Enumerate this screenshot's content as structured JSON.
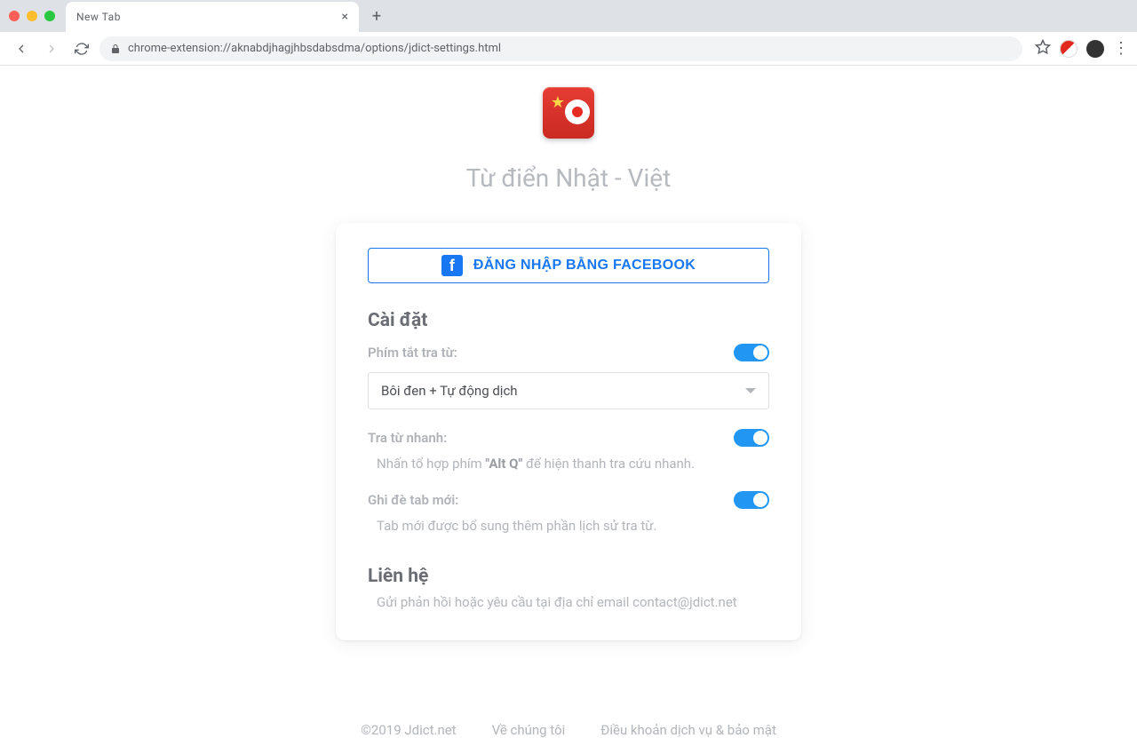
{
  "browser": {
    "tab_title": "New Tab",
    "url": "chrome-extension://aknabdjhagjhbsdabsdma/options/jdict-settings.html"
  },
  "header": {
    "logo_name": "jdict-logo",
    "title": "Từ điển Nhật - Việt"
  },
  "fb_login": {
    "label": "ĐĂNG NHẬP BẰNG FACEBOOK"
  },
  "settings": {
    "section_title": "Cài đặt",
    "shortcut": {
      "label": "Phím tắt tra từ:",
      "selected": "Bôi đen + Tự động dịch",
      "toggle_on": true
    },
    "quick_lookup": {
      "label": "Tra từ nhanh:",
      "desc_pre": "Nhấn tổ hợp phím ",
      "desc_key": "\"Alt Q\"",
      "desc_post": " để hiện thanh tra cứu nhanh.",
      "toggle_on": true
    },
    "override_tab": {
      "label": "Ghi đè tab mới:",
      "desc": "Tab mới được bổ sung thêm phần lịch sử tra từ.",
      "toggle_on": true
    }
  },
  "contact": {
    "section_title": "Liên hệ",
    "text": "Gửi phản hồi hoặc yêu cầu tại địa chỉ email contact@jdict.net"
  },
  "footer": {
    "copyright": "©2019 Jdict.net",
    "about": "Về chúng tôi",
    "terms": "Điều khoản dịch vụ & bảo mật"
  }
}
